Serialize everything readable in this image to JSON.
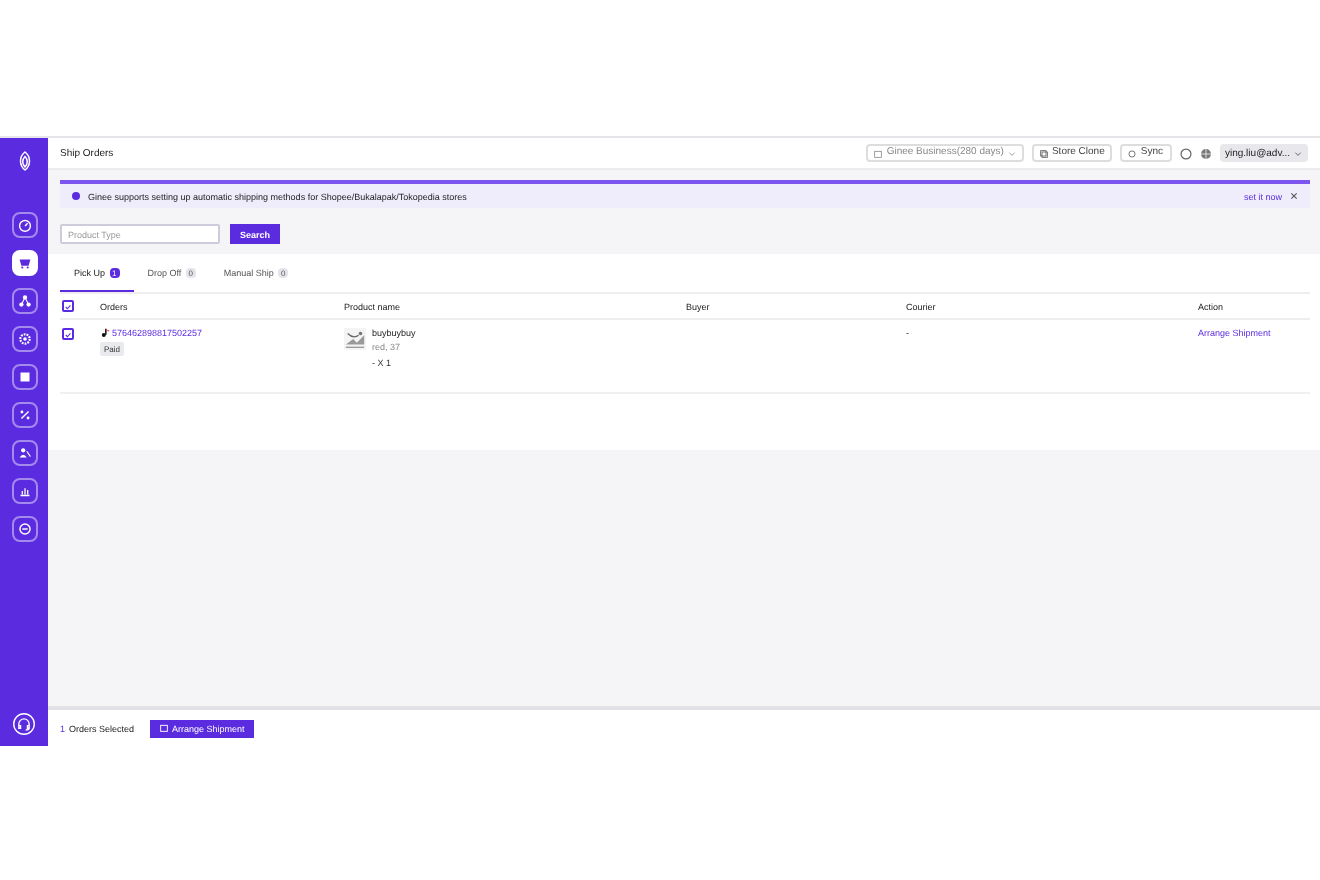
{
  "sidebar": {
    "items": [
      {
        "selected": false
      },
      {
        "selected": true
      },
      {
        "selected": false
      },
      {
        "selected": false
      },
      {
        "selected": false
      },
      {
        "selected": false
      },
      {
        "selected": false
      },
      {
        "selected": false
      },
      {
        "selected": false
      }
    ]
  },
  "topbar": {
    "title": "Ship Orders",
    "store_selector": "Ginee Business(280 days)",
    "buttons": [
      "Store Clone",
      "Sync"
    ],
    "account": "ying.liu@adv..."
  },
  "banner": {
    "text": "Ginee supports setting up automatic shipping methods for Shopee/Bukalapak/Tokopedia stores",
    "link": "set it now"
  },
  "search": {
    "placeholder": "Product Type",
    "button": "Search"
  },
  "tabs": [
    {
      "label": "Pick Up",
      "count": "1",
      "selected": true
    },
    {
      "label": "Drop Off",
      "count": "0",
      "selected": false
    },
    {
      "label": "Manual Ship",
      "count": "0",
      "selected": false
    }
  ],
  "table": {
    "all_checked": true,
    "columns": [
      "Orders",
      "Product name",
      "Buyer",
      "Courier",
      "Action"
    ],
    "rows": [
      {
        "checked": true,
        "order_no": "576462898817502257",
        "status": "Paid",
        "product": {
          "kind": "picture",
          "name": "buybuybuy",
          "variant": "red, 37",
          "quantity": "- X 1"
        },
        "buyer": "",
        "courier": "-",
        "action": "Arrange Shipment"
      }
    ]
  },
  "footer": {
    "count": "1",
    "label": "Orders Selected",
    "button": "Arrange Shipment"
  }
}
